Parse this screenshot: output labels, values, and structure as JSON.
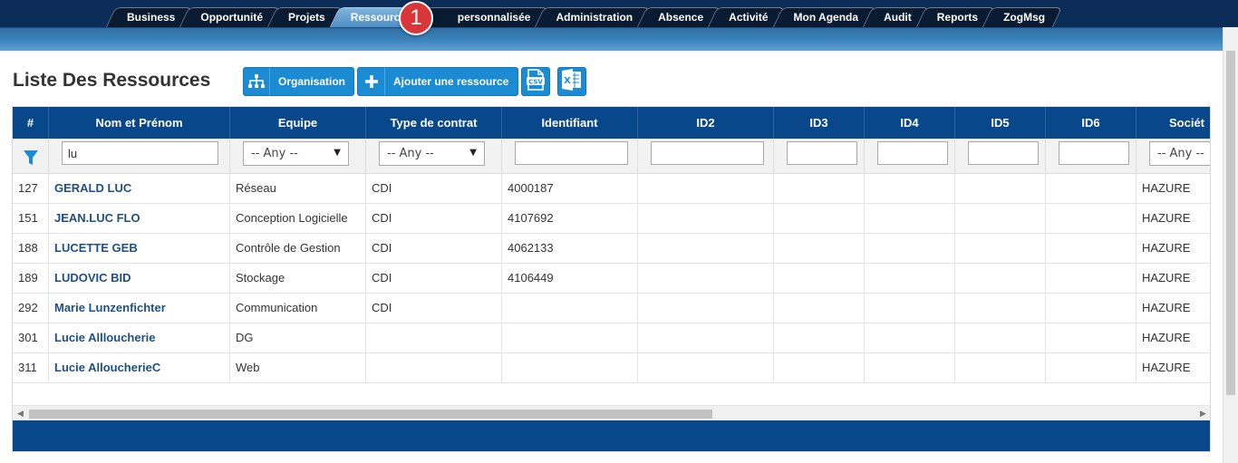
{
  "nav": {
    "tabs": [
      "Business",
      "Opportunité",
      "Projets",
      "Ressources",
      "personnalisée",
      "Administration",
      "Absence",
      "Activité",
      "Mon Agenda",
      "Audit",
      "Reports",
      "ZogMsg"
    ],
    "active_tab": "Ressources",
    "badge": "1"
  },
  "page": {
    "title": "Liste Des Ressources",
    "btn_org": "Organisation",
    "btn_add": "Ajouter une ressource",
    "icons": [
      "sitemap-icon",
      "plus-icon",
      "csv-icon",
      "excel-icon"
    ]
  },
  "grid": {
    "columns": [
      "#",
      "Nom et Prénom",
      "Equipe",
      "Type de contrat",
      "Identifiant",
      "ID2",
      "ID3",
      "ID4",
      "ID5",
      "ID6",
      "Sociét"
    ],
    "filters": {
      "name": "lu",
      "equipe": "-- Any --",
      "contrat": "-- Any --",
      "societe": "-- Any --"
    },
    "rows": [
      [
        "127",
        "GERALD LUC",
        "Réseau",
        "CDI",
        "4000187",
        "",
        "",
        "",
        "",
        "",
        "HAZURE"
      ],
      [
        "151",
        "JEAN.LUC FLO",
        "Conception Logicielle",
        "CDI",
        "4107692",
        "",
        "",
        "",
        "",
        "",
        "HAZURE"
      ],
      [
        "188",
        "LUCETTE GEB",
        "Contrôle de Gestion",
        "CDI",
        "4062133",
        "",
        "",
        "",
        "",
        "",
        "HAZURE"
      ],
      [
        "189",
        "LUDOVIC BID",
        "Stockage",
        "CDI",
        "4106449",
        "",
        "",
        "",
        "",
        "",
        "HAZURE"
      ],
      [
        "292",
        "Marie Lunzenfichter",
        "Communication",
        "CDI",
        "",
        "",
        "",
        "",
        "",
        "",
        "HAZURE"
      ],
      [
        "301",
        "Lucie Allloucherie",
        "DG",
        "",
        "",
        "",
        "",
        "",
        "",
        "",
        "HAZURE"
      ],
      [
        "311",
        "Lucie AlloucherieC",
        "Web",
        "",
        "",
        "",
        "",
        "",
        "",
        "",
        "HAZURE"
      ]
    ]
  },
  "colors": {
    "header_blue": "#08478a",
    "button_blue": "#1b8bd4",
    "link_blue": "#1f4f86",
    "badge_red": "#d9363a"
  }
}
